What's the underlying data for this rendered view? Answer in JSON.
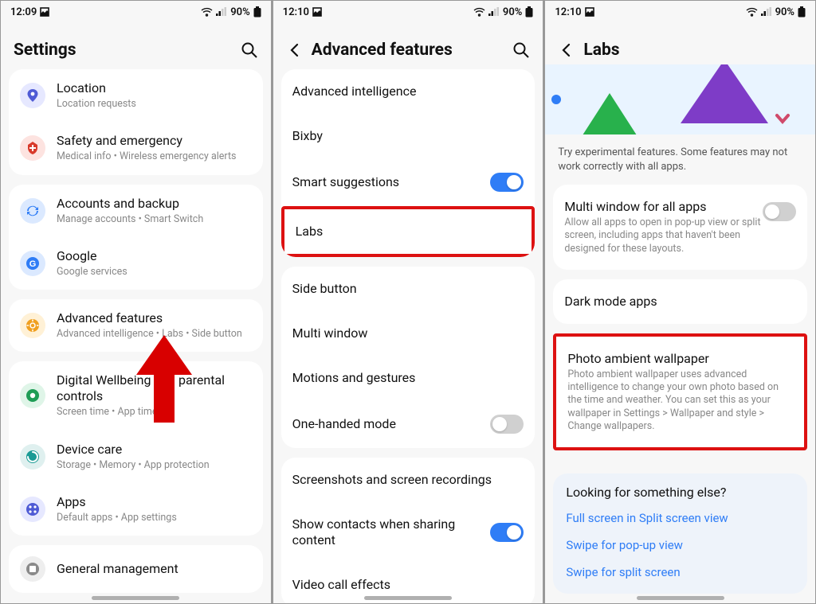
{
  "status_time_1": "12:09",
  "status_time_2": "12:10",
  "status_time_3": "12:10",
  "battery_pct": "90%",
  "s1": {
    "title": "Settings",
    "items": {
      "location": {
        "label": "Location",
        "sub": "Location requests"
      },
      "safety": {
        "label": "Safety and emergency",
        "sub": "Medical info  •  Wireless emergency alerts"
      },
      "accounts": {
        "label": "Accounts and backup",
        "sub": "Manage accounts  •  Smart Switch"
      },
      "google": {
        "label": "Google",
        "sub": "Google services"
      },
      "advanced": {
        "label": "Advanced features",
        "sub": "Advanced intelligence  •  Labs  •  Side button"
      },
      "wellbeing": {
        "label": "Digital Wellbeing and parental controls",
        "sub": "Screen time  •  App timers"
      },
      "devicecare": {
        "label": "Device care",
        "sub": "Storage  •  Memory  •  App protection"
      },
      "apps": {
        "label": "Apps",
        "sub": "Default apps  •  App settings"
      },
      "general": {
        "label": "General management",
        "sub": ""
      }
    }
  },
  "s2": {
    "title": "Advanced features",
    "items": {
      "ai": "Advanced intelligence",
      "bixby": "Bixby",
      "smart": "Smart suggestions",
      "labs": "Labs",
      "side": "Side button",
      "multiwin": "Multi window",
      "motions": "Motions and gestures",
      "onehand": "One-handed mode",
      "sshot": "Screenshots and screen recordings",
      "contacts": "Show contacts when sharing content",
      "video": "Video call effects"
    }
  },
  "s3": {
    "title": "Labs",
    "desc": "Try experimental features. Some features may not work correctly with all apps.",
    "multiwin": {
      "label": "Multi window for all apps",
      "sub": "Allow all apps to open in pop-up view or split screen, including apps that haven't been designed for these layouts."
    },
    "darkmode": "Dark mode apps",
    "photo": {
      "label": "Photo ambient wallpaper",
      "sub": "Photo ambient wallpaper uses advanced intelligence to change your own photo based on the time and weather. You can set this as your wallpaper in Settings > Wallpaper and style > Change wallpapers."
    },
    "looking": {
      "head": "Looking for something else?",
      "l1": "Full screen in Split screen view",
      "l2": "Swipe for pop-up view",
      "l3": "Swipe for split screen"
    }
  }
}
